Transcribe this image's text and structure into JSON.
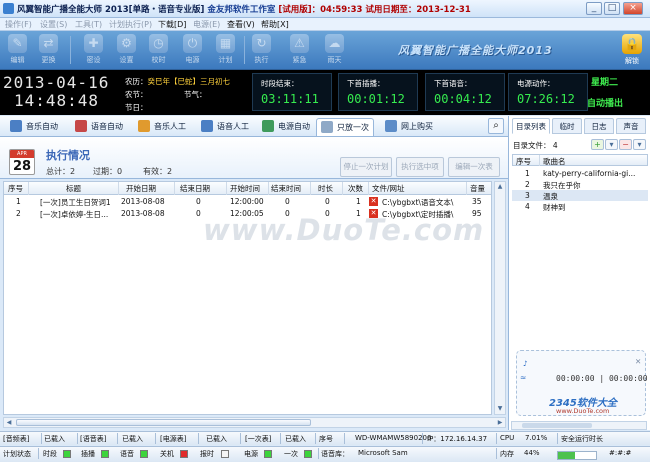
{
  "window": {
    "title": "风翼智能广播全能大师 2013[单路・语音专业版]",
    "company": "金友邦软件工作室",
    "trial_info": "[试用版]：04:59:33 试用日期至：2013-12-31",
    "minimize": "_",
    "maximize": "□",
    "close": "×"
  },
  "menu": [
    {
      "label": "操作(F)",
      "enabled": false
    },
    {
      "label": "设置(S)",
      "enabled": false
    },
    {
      "label": "工具(T)",
      "enabled": false
    },
    {
      "label": "计划执行(P)",
      "enabled": false
    },
    {
      "label": "下载[D]",
      "enabled": true
    },
    {
      "label": "电源(E)",
      "enabled": false
    },
    {
      "label": "查看(V)",
      "enabled": true
    },
    {
      "label": "帮助[X]",
      "enabled": true
    }
  ],
  "toolbar": {
    "buttons": [
      "编辑",
      "更换",
      "密设",
      "设置",
      "校时",
      "电源",
      "计划",
      "执行",
      "紧急",
      "雨天"
    ],
    "logo": "风翼智能广播全能大师2013",
    "unlock": "解锁"
  },
  "clock": {
    "date": "2013-04-16",
    "time": "14:48:48",
    "lunar_label": "农历：",
    "lunar_value": "癸巳年【巳蛇】三月初七",
    "farm_label": "农节：",
    "farm_value": "",
    "solar_term_label": "节气：",
    "solar_term_value": "",
    "festival_label": "节日：",
    "festival_value": ""
  },
  "counters": [
    {
      "label": "时段结束：",
      "value": "03:11:11"
    },
    {
      "label": "下首插播：",
      "value": "00:01:12"
    },
    {
      "label": "下首语音：",
      "value": "00:04:12"
    },
    {
      "label": "电源动作：",
      "value": "07:26:12"
    }
  ],
  "weekday": "星期二",
  "auto_play": "自动播出",
  "tabs": [
    "音乐自动",
    "语音自动",
    "音乐人工",
    "语音人工",
    "电源自动",
    "只放一次",
    "网上购买"
  ],
  "active_tab": "只放一次",
  "tasks": {
    "title": "执行情况",
    "total_label": "总计：",
    "total": "2",
    "expired_label": "过期：",
    "expired": "0",
    "valid_label": "有效：",
    "valid": "2",
    "actions": [
      "停止一次计划",
      "执行选中项",
      "编辑一次表"
    ]
  },
  "table": {
    "columns": [
      "序号",
      "标题",
      "开始日期",
      "结束日期",
      "开始时间",
      "结束时间",
      "时长",
      "次数",
      "文件/网址",
      "音量"
    ],
    "rows": [
      {
        "no": "1",
        "title": "[一次]员工生日贺词1",
        "start_date": "2013-08-08",
        "end_date": "0",
        "start_time": "12:00:00",
        "end_time": "0",
        "duration": "0",
        "times": "1",
        "file": "C:\\ybgbxt\\语音文本\\",
        "volume": "35"
      },
      {
        "no": "2",
        "title": "[一次]卓依婷-生日...",
        "start_date": "2013-08-08",
        "end_date": "0",
        "start_time": "12:00:05",
        "end_time": "0",
        "duration": "0",
        "times": "1",
        "file": "C:\\ybgbxt\\定时插播\\",
        "volume": "95"
      }
    ]
  },
  "playlist": {
    "tabs": [
      "目录列表",
      "临时",
      "日志",
      "声音"
    ],
    "active_tab": "目录列表",
    "files_label": "目录文件：",
    "files_count": "4",
    "columns": [
      "序号",
      "歌曲名"
    ],
    "rows": [
      {
        "no": "1",
        "name": "katy-perry-california-gi..."
      },
      {
        "no": "2",
        "name": "我只在乎你"
      },
      {
        "no": "3",
        "name": "温泉"
      },
      {
        "no": "4",
        "name": "财神到"
      }
    ],
    "selected_index": 2,
    "dial_elapsed": "00:00:00",
    "dial_total": "00:00:00"
  },
  "status1": [
    "[音频表]",
    "已载入",
    "[语音表]",
    "已载入",
    "[电源表]",
    "已载入",
    "[一次表]",
    "已载入",
    "序号",
    "WD-WMAMW5890206",
    "IP：172.16.14.37",
    "CPU",
    "7.01%",
    "安全运行时长"
  ],
  "status2": {
    "exec_label": "计划状态",
    "items": [
      {
        "label": "时段",
        "color": "g"
      },
      {
        "label": "插播",
        "color": "g"
      },
      {
        "label": "语音",
        "color": "g"
      },
      {
        "label": "关机",
        "color": "r"
      },
      {
        "label": "报时",
        "color": "w"
      },
      {
        "label": "电源",
        "color": "g"
      },
      {
        "label": "一次",
        "color": "g"
      }
    ],
    "voice_label": "语音库：",
    "voice_value": "Microsoft Sam",
    "memory_label": "内存",
    "memory_value": "44%",
    "memory_percent": 44,
    "tail": "#:#:#"
  },
  "watermark": "www.DuoTe.com",
  "watermark2": "2345软件大全",
  "watermark3": "www.DuoTe.com"
}
